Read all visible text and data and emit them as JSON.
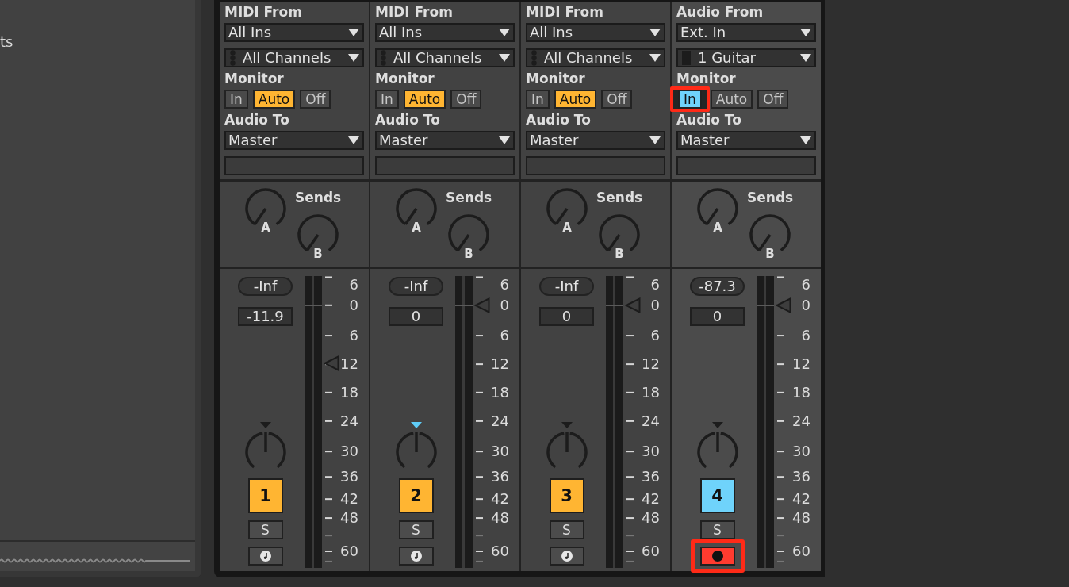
{
  "browser": {
    "text": "ts"
  },
  "tracks": [
    {
      "selected": false,
      "kind": "midi",
      "input_label": "MIDI From",
      "input_type": "All Ins",
      "input_channel": "All Channels",
      "monitor_label": "Monitor",
      "monitor": [
        {
          "label": "In",
          "selected": false,
          "highlighted": false
        },
        {
          "label": "Auto",
          "selected": true,
          "highlighted": false
        },
        {
          "label": "Off",
          "selected": false,
          "highlighted": false
        }
      ],
      "output_label": "Audio To",
      "output_type": "Master",
      "sends_label": "Sends",
      "sends": [
        {
          "label": "A"
        },
        {
          "label": "B"
        }
      ],
      "peak": "-Inf",
      "volume": "-11.9",
      "fader": {
        "level": 0.7
      },
      "scale": [
        "6",
        "0",
        "6",
        "12",
        "18",
        "24",
        "30",
        "36",
        "42",
        "48",
        "60"
      ],
      "pan": {
        "marker_highlighted": false
      },
      "activator": {
        "label": "1",
        "on": true
      },
      "solo": {
        "label": "S",
        "on": false
      },
      "arm": {
        "armed": false,
        "highlighted": false
      }
    },
    {
      "selected": false,
      "kind": "midi",
      "input_label": "MIDI From",
      "input_type": "All Ins",
      "input_channel": "All Channels",
      "monitor_label": "Monitor",
      "monitor": [
        {
          "label": "In",
          "selected": false,
          "highlighted": false
        },
        {
          "label": "Auto",
          "selected": true,
          "highlighted": false
        },
        {
          "label": "Off",
          "selected": false,
          "highlighted": false
        }
      ],
      "output_label": "Audio To",
      "output_type": "Master",
      "sends_label": "Sends",
      "sends": [
        {
          "label": "A"
        },
        {
          "label": "B"
        }
      ],
      "peak": "-Inf",
      "volume": "0",
      "fader": {
        "level": 0.9
      },
      "scale": [
        "6",
        "0",
        "6",
        "12",
        "18",
        "24",
        "30",
        "36",
        "42",
        "48",
        "60"
      ],
      "pan": {
        "marker_highlighted": true
      },
      "activator": {
        "label": "2",
        "on": true
      },
      "solo": {
        "label": "S",
        "on": false
      },
      "arm": {
        "armed": false,
        "highlighted": false
      }
    },
    {
      "selected": false,
      "kind": "midi",
      "input_label": "MIDI From",
      "input_type": "All Ins",
      "input_channel": "All Channels",
      "monitor_label": "Monitor",
      "monitor": [
        {
          "label": "In",
          "selected": false,
          "highlighted": false
        },
        {
          "label": "Auto",
          "selected": true,
          "highlighted": false
        },
        {
          "label": "Off",
          "selected": false,
          "highlighted": false
        }
      ],
      "output_label": "Audio To",
      "output_type": "Master",
      "sends_label": "Sends",
      "sends": [
        {
          "label": "A"
        },
        {
          "label": "B"
        }
      ],
      "peak": "-Inf",
      "volume": "0",
      "fader": {
        "level": 0.9
      },
      "scale": [
        "6",
        "0",
        "6",
        "12",
        "18",
        "24",
        "30",
        "36",
        "42",
        "48",
        "60"
      ],
      "pan": {
        "marker_highlighted": false
      },
      "activator": {
        "label": "3",
        "on": true
      },
      "solo": {
        "label": "S",
        "on": false
      },
      "arm": {
        "armed": false,
        "highlighted": false
      }
    },
    {
      "selected": true,
      "kind": "audio",
      "input_label": "Audio From",
      "input_type": "Ext. In",
      "input_channel": "1 Guitar",
      "monitor_label": "Monitor",
      "monitor": [
        {
          "label": "In",
          "selected": true,
          "highlighted": true
        },
        {
          "label": "Auto",
          "selected": false,
          "highlighted": false
        },
        {
          "label": "Off",
          "selected": false,
          "highlighted": false
        }
      ],
      "output_label": "Audio To",
      "output_type": "Master",
      "sends_label": "Sends",
      "sends": [
        {
          "label": "A"
        },
        {
          "label": "B"
        }
      ],
      "peak": "-87.3",
      "volume": "0",
      "fader": {
        "level": 0.9
      },
      "scale": [
        "6",
        "0",
        "6",
        "12",
        "18",
        "24",
        "30",
        "36",
        "42",
        "48",
        "60"
      ],
      "pan": {
        "marker_highlighted": false
      },
      "activator": {
        "label": "4",
        "on": true
      },
      "solo": {
        "label": "S",
        "on": false
      },
      "arm": {
        "armed": true,
        "highlighted": true
      }
    }
  ]
}
